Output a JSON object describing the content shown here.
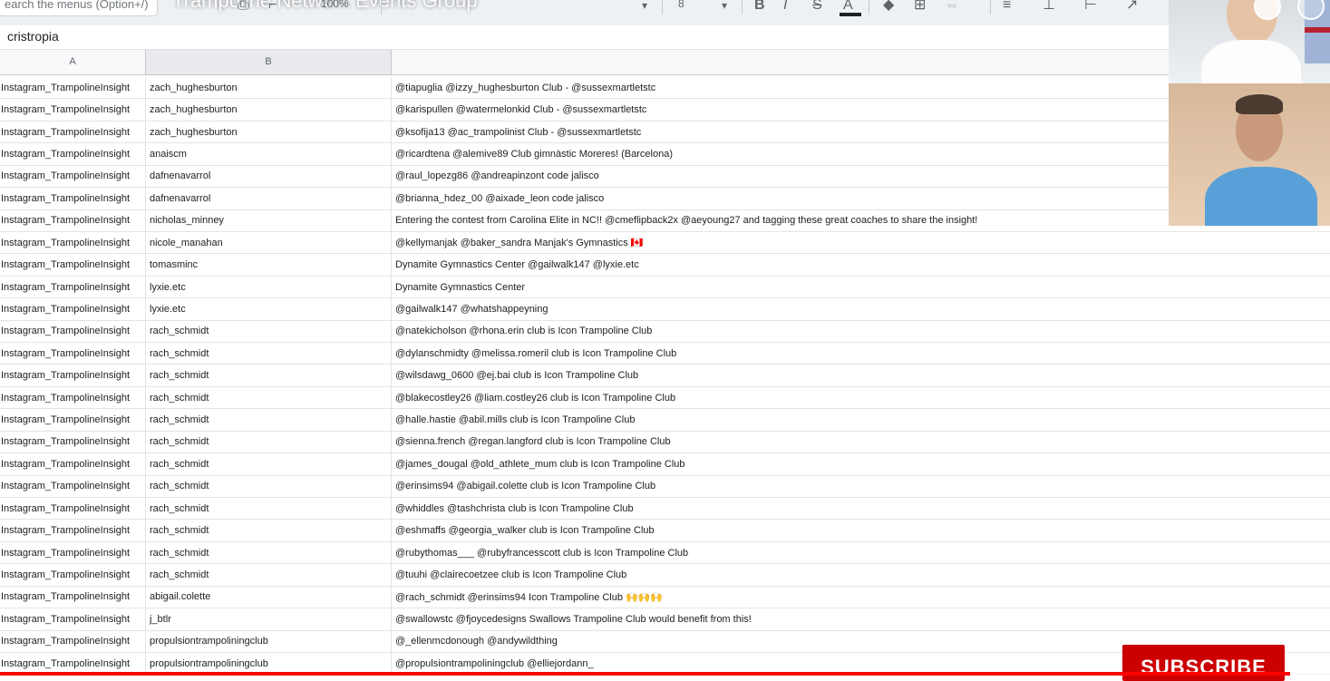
{
  "toolbar": {
    "menu_search_placeholder": "earch the menus (Option+/)",
    "video_title": "Trampoline Network Events Group",
    "font_size": "8",
    "zoom": "100%",
    "icons": [
      "undo-icon",
      "print-icon",
      "format-paint-icon",
      "bold-icon",
      "italic-icon",
      "strikethrough-icon",
      "text-color-icon",
      "fill-color-icon",
      "borders-icon",
      "merge-icon",
      "align-icon",
      "valign-icon",
      "wrap-icon",
      "rotate-icon"
    ]
  },
  "formula_bar": {
    "value": "cristropia"
  },
  "columns": [
    {
      "header": "A"
    },
    {
      "header": "B"
    },
    {
      "header": ""
    }
  ],
  "rows": [
    [
      "Instagram_TrampolineInsight",
      "zach_hughesburton",
      "@tiapuglia @izzy_hughesburton Club - @sussexmartletstc"
    ],
    [
      "Instagram_TrampolineInsight",
      "zach_hughesburton",
      "@karispullen @watermelonkid Club - @sussexmartletstc"
    ],
    [
      "Instagram_TrampolineInsight",
      "zach_hughesburton",
      "@ksofija13 @ac_trampolinist Club - @sussexmartletstc"
    ],
    [
      "Instagram_TrampolineInsight",
      "anaiscm",
      "@ricardtena @alemive89 Club gimnàstic Moreres! (Barcelona)"
    ],
    [
      "Instagram_TrampolineInsight",
      "dafnenavarrol",
      "@raul_lopezg86 @andreapinzont code jalisco"
    ],
    [
      "Instagram_TrampolineInsight",
      "dafnenavarrol",
      "@brianna_hdez_00 @aixade_leon code jalisco"
    ],
    [
      "Instagram_TrampolineInsight",
      "nicholas_minney",
      "Entering the contest from Carolina Elite in NC!! @cmeflipback2x @aeyoung27 and tagging these great coaches to share the insight!"
    ],
    [
      "Instagram_TrampolineInsight",
      "nicole_manahan",
      "@kellymanjak @baker_sandra Manjak's Gymnastics 🇨🇦"
    ],
    [
      "Instagram_TrampolineInsight",
      "tomasminc",
      "Dynamite Gymnastics Center @gailwalk147 @lyxie.etc"
    ],
    [
      "Instagram_TrampolineInsight",
      "lyxie.etc",
      "Dynamite Gymnastics Center"
    ],
    [
      "Instagram_TrampolineInsight",
      "lyxie.etc",
      "@gailwalk147 @whatshappeyning"
    ],
    [
      "Instagram_TrampolineInsight",
      "rach_schmidt",
      "@natekicholson @rhona.erin club is Icon Trampoline Club"
    ],
    [
      "Instagram_TrampolineInsight",
      "rach_schmidt",
      "@dylanschmidty @melissa.romeril club is Icon Trampoline Club"
    ],
    [
      "Instagram_TrampolineInsight",
      "rach_schmidt",
      "@wilsdawg_0600 @ej.bai club is Icon Trampoline Club"
    ],
    [
      "Instagram_TrampolineInsight",
      "rach_schmidt",
      "@blakecostley26 @liam.costley26 club is Icon Trampoline Club"
    ],
    [
      "Instagram_TrampolineInsight",
      "rach_schmidt",
      "@halle.hastie @abil.mills club is Icon Trampoline Club"
    ],
    [
      "Instagram_TrampolineInsight",
      "rach_schmidt",
      "@sienna.french @regan.langford club is Icon Trampoline Club"
    ],
    [
      "Instagram_TrampolineInsight",
      "rach_schmidt",
      "@james_dougal @old_athlete_mum club is Icon Trampoline Club"
    ],
    [
      "Instagram_TrampolineInsight",
      "rach_schmidt",
      "@erinsims94 @abigail.colette club is Icon Trampoline Club"
    ],
    [
      "Instagram_TrampolineInsight",
      "rach_schmidt",
      "@whiddles @tashchrista club is Icon Trampoline Club"
    ],
    [
      "Instagram_TrampolineInsight",
      "rach_schmidt",
      "@eshmaffs @georgia_walker club is Icon Trampoline Club"
    ],
    [
      "Instagram_TrampolineInsight",
      "rach_schmidt",
      "@rubythomas___ @rubyfrancesscott club is Icon Trampoline Club"
    ],
    [
      "Instagram_TrampolineInsight",
      "rach_schmidt",
      "@tuuhi @clairecoetzee club is Icon Trampoline Club"
    ],
    [
      "Instagram_TrampolineInsight",
      "abigail.colette",
      "@rach_schmidt @erinsims94 Icon Trampoline Club 🙌🙌🙌"
    ],
    [
      "Instagram_TrampolineInsight",
      "j_btlr",
      "@swallowstc @fjoycedesigns Swallows Trampoline Club would benefit from this!"
    ],
    [
      "Instagram_TrampolineInsight",
      "propulsiontrampoliningclub",
      "@_ellenmcdonough @andywildthing"
    ],
    [
      "Instagram_TrampolineInsight",
      "propulsiontrampoliningclub",
      "@propulsiontrampoliningclub @elliejordann_"
    ]
  ],
  "overlay": {
    "subscribe_label": "SUBSCRIBE",
    "progress_fraction": 0.97,
    "colors": {
      "subscribe": "#cc0000",
      "progress": "#ff0000"
    }
  }
}
